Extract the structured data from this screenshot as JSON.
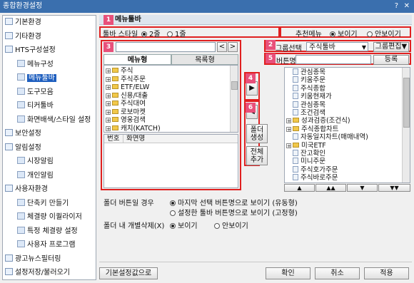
{
  "window": {
    "title": "종합환경설정",
    "help": "?",
    "close": "✕"
  },
  "tree": [
    {
      "label": "기본환경",
      "level": 0
    },
    {
      "label": "기타환경",
      "level": 0
    },
    {
      "label": "HTS구성설정",
      "level": 0
    },
    {
      "label": "메뉴구성",
      "level": 1
    },
    {
      "label": "메뉴툴바",
      "level": 1,
      "selected": true
    },
    {
      "label": "도구모음",
      "level": 1
    },
    {
      "label": "티커툴바",
      "level": 1
    },
    {
      "label": "화면배색/스타일 설정",
      "level": 1
    },
    {
      "label": "보안설정",
      "level": 0
    },
    {
      "label": "알림설정",
      "level": 0
    },
    {
      "label": "시장알림",
      "level": 1
    },
    {
      "label": "개인알림",
      "level": 1
    },
    {
      "label": "사용자환경",
      "level": 0
    },
    {
      "label": "단축키 만들기",
      "level": 1
    },
    {
      "label": "체결량 이퀄라이저",
      "level": 1
    },
    {
      "label": "특정 체결량 설정",
      "level": 1
    },
    {
      "label": "사용자 프로그램",
      "level": 1
    },
    {
      "label": "광고뉴스필터링",
      "level": 0
    },
    {
      "label": "설정저장/불러오기",
      "level": 0
    }
  ],
  "section_title": "메뉴툴바",
  "badges": [
    "1",
    "2",
    "3",
    "4",
    "5",
    "6"
  ],
  "toolbar_style": {
    "label": "툴바 스타일",
    "options": [
      "2줄",
      "1줄"
    ],
    "selected": "2줄"
  },
  "recommend_menu": {
    "label": "추천메뉴",
    "options": [
      "보이기",
      "안보이기"
    ],
    "selected": "보이기"
  },
  "search": {
    "value": "",
    "prev": "<",
    "next": ">"
  },
  "tabs": {
    "menu": "메뉴형",
    "list": "목록형"
  },
  "left_list": [
    {
      "label": "주식",
      "type": "folder"
    },
    {
      "label": "주식주문",
      "type": "folder"
    },
    {
      "label": "ETF/ELW",
      "type": "folder"
    },
    {
      "label": "신용/대출",
      "type": "folder"
    },
    {
      "label": "주식대여",
      "type": "folder"
    },
    {
      "label": "로보마켓",
      "type": "folder"
    },
    {
      "label": "영웅검색",
      "type": "folder"
    },
    {
      "label": "캐치(KATCH)",
      "type": "folder"
    }
  ],
  "bottom_table": {
    "col1": "번호",
    "col2": "화면명"
  },
  "arrow_buttons": {
    "add": "▶",
    "remove": "◀"
  },
  "folder_btn": "폴더 생성",
  "addall_btn": "전체 추가",
  "group": {
    "label": "그룹선택",
    "value": "주식툴바",
    "edit": "그룹편집▼"
  },
  "button_name": {
    "label": "버튼명",
    "value": "",
    "register": "등록"
  },
  "right_list": [
    {
      "label": "관심종목",
      "type": "doc"
    },
    {
      "label": "키움주문",
      "type": "doc"
    },
    {
      "label": "주식종합",
      "type": "doc"
    },
    {
      "label": "키움현재가",
      "type": "doc"
    },
    {
      "label": "관심종목",
      "type": "doc"
    },
    {
      "label": "조건검색",
      "type": "doc"
    },
    {
      "label": "성과검증(조건식)",
      "type": "folder"
    },
    {
      "label": "주식종합차트",
      "type": "folder"
    },
    {
      "label": "자동일지차트(매매내역)",
      "type": "doc"
    },
    {
      "label": "미국ETF",
      "type": "folder"
    },
    {
      "label": "잔고확인",
      "type": "doc"
    },
    {
      "label": "미니주문",
      "type": "doc"
    },
    {
      "label": "주식호가주문",
      "type": "doc"
    },
    {
      "label": "주식바로주문",
      "type": "doc"
    }
  ],
  "order_buttons": [
    "▲",
    "▲▲",
    "▼",
    "▼▼"
  ],
  "folder_btn_option": {
    "label": "폴더 버튼일 경우",
    "options": [
      "마지막 선택 버튼명으로 보이기 (유동형)",
      "설정한 툴바 버튼명으로 보이기 (고정형)"
    ],
    "selected": 0
  },
  "folder_delete": {
    "label": "폴더 내 개별삭제(X)",
    "options": [
      "보이기",
      "안보이기"
    ],
    "selected": 0
  },
  "footer": {
    "reset": "기본설정값으로",
    "ok": "확인",
    "cancel": "취소",
    "apply": "적용"
  }
}
